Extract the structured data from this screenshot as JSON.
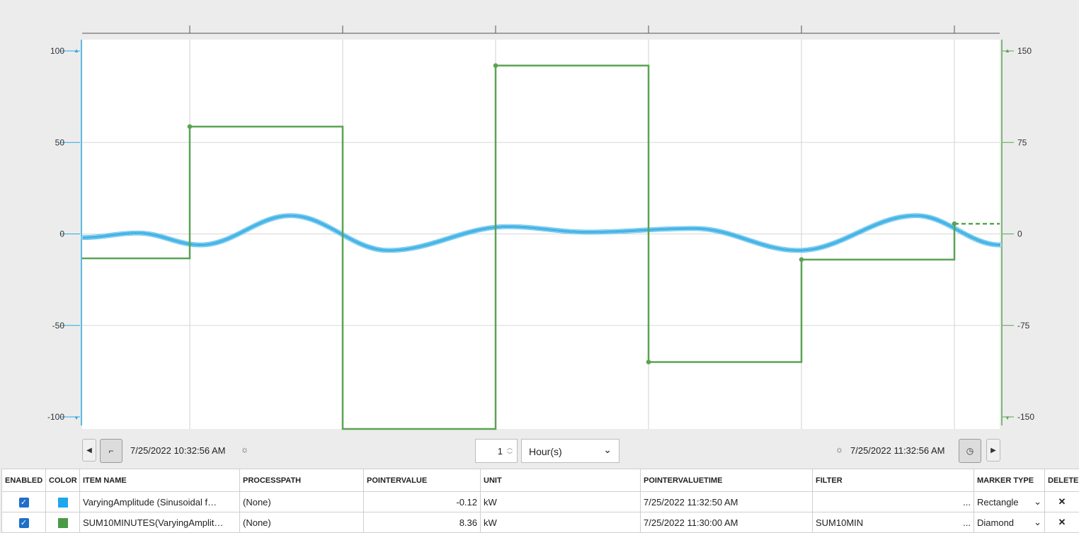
{
  "chart_data": {
    "type": "line",
    "y_left": {
      "ticks": [
        "100",
        "50",
        "0",
        "-50",
        "-100"
      ],
      "range": [
        -100,
        100
      ],
      "color": "#29a8e0"
    },
    "y_right": {
      "ticks": [
        "150",
        "75",
        "0",
        "-75",
        "-150"
      ],
      "range": [
        -150,
        150
      ],
      "color": "#5aa352"
    },
    "x_range": [
      "7/25/2022 10:32:56 AM",
      "7/25/2022 11:32:56 AM"
    ],
    "grid": true,
    "series": [
      {
        "axis": "left",
        "color": "#29a8e0",
        "marker": "Rectangle",
        "style": "sinusoid",
        "minutes": [
          0,
          3.6,
          7.7,
          13.6,
          20,
          27.8,
          33,
          40,
          46.8,
          54.5,
          60
        ],
        "values": [
          -2,
          0.5,
          -6,
          10,
          -9,
          4,
          1,
          3,
          -9,
          10,
          -6,
          0
        ]
      },
      {
        "axis": "right",
        "color": "#5aa352",
        "marker": "Diamond",
        "style": "step",
        "minutes": [
          0,
          7,
          17,
          27,
          37,
          47,
          57
        ],
        "values": [
          -20,
          88,
          -300,
          138,
          -105,
          -21,
          8.36
        ]
      }
    ]
  },
  "controls": {
    "start_time": "7/25/2022 10:32:56 AM",
    "end_time": "7/25/2022 11:32:56 AM",
    "duration_value": "1",
    "duration_unit": "Hour(s)"
  },
  "table": {
    "headers": [
      "ENABLED",
      "COLOR",
      "ITEM NAME",
      "PROCESSPATH",
      "POINTERVALUE",
      "UNIT",
      "POINTERVALUETIME",
      "FILTER",
      "MARKER TYPE",
      "DELETE"
    ],
    "rows": [
      {
        "color": "#1ea6ee",
        "item_name": "VaryingAmplitude (Sinusoidal f…",
        "processpath": "(None)",
        "pointervalue": "-0.12",
        "unit": "kW",
        "pointervaluetime": "7/25/2022 11:32:50 AM",
        "filter": "",
        "marker": "Rectangle"
      },
      {
        "color": "#4a9a45",
        "item_name": "SUM10MINUTES(VaryingAmplit…",
        "processpath": "(None)",
        "pointervalue": "8.36",
        "unit": "kW",
        "pointervaluetime": "7/25/2022 11:30:00 AM",
        "filter": "SUM10MIN",
        "marker": "Diamond"
      }
    ],
    "ellipsis": "..."
  }
}
